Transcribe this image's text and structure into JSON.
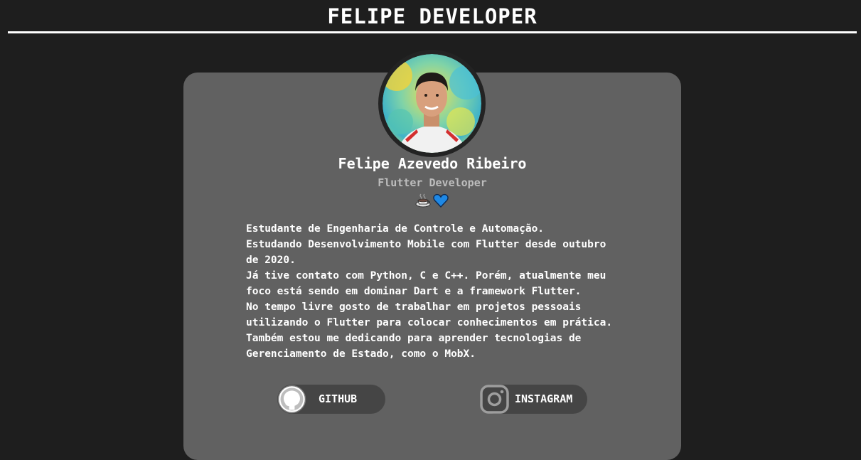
{
  "header": {
    "title": "FELIPE DEVELOPER"
  },
  "profile": {
    "name": "Felipe Azevedo Ribeiro",
    "role": "Flutter Developer",
    "emojis": [
      "coffee-icon",
      "blue-heart-icon"
    ]
  },
  "bio": {
    "lines": [
      "Estudante de Engenharia de Controle e Automação.",
      "Estudando Desenvolvimento Mobile com Flutter desde outubro",
      "de 2020.",
      "Já tive contato com Python, C e C++. Porém, atualmente meu",
      "foco está sendo em dominar Dart e a framework Flutter.",
      "No tempo livre gosto de trabalhar em projetos pessoais",
      "utilizando o Flutter para colocar conhecimentos em prática.",
      "Também estou me dedicando para aprender tecnologias de",
      "Gerenciamento de Estado, como o MobX."
    ]
  },
  "social": {
    "github_label": "GITHUB",
    "instagram_label": "INSTAGRAM"
  },
  "colors": {
    "background": "#1e1e1e",
    "card": "#616161",
    "button": "#454545",
    "role_text": "#bdbdbd",
    "heart": "#1e88e5"
  }
}
